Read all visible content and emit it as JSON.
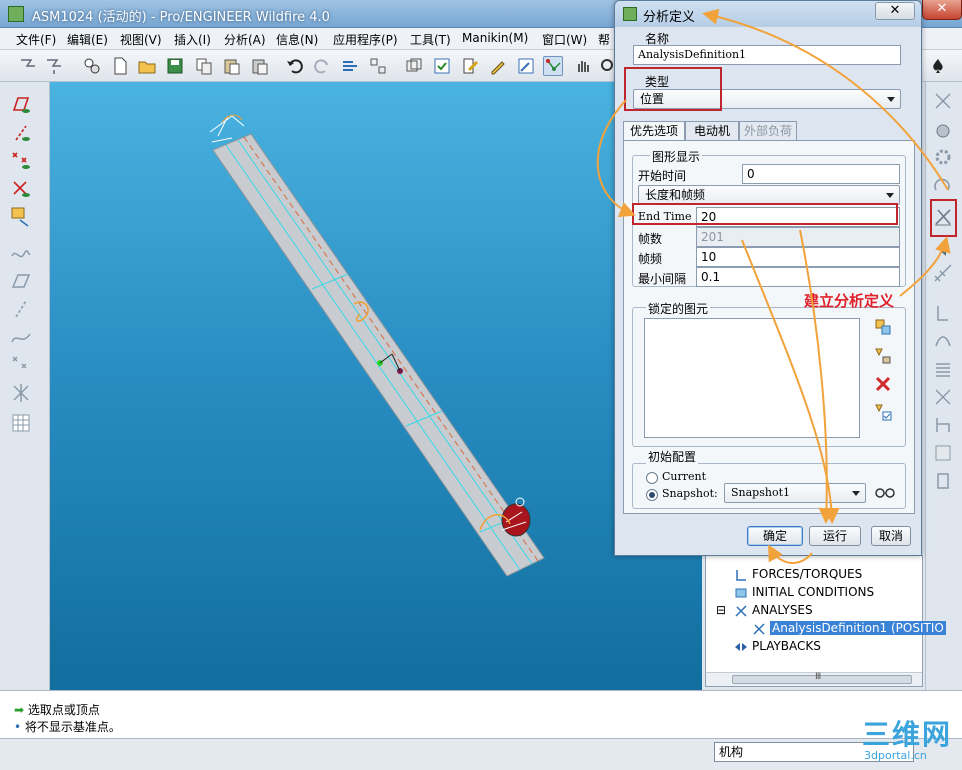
{
  "window": {
    "title": "ASM1024 (活动的) - Pro/ENGINEER Wildfire 4.0",
    "close_glyph": "✕"
  },
  "menu": [
    "文件(F)",
    "编辑(E)",
    "视图(V)",
    "插入(I)",
    "分析(A)",
    "信息(N)",
    "应用程序(P)",
    "工具(T)",
    "Manikin(M)",
    "窗口(W)",
    "帮"
  ],
  "dialog": {
    "title": "分析定义",
    "close_glyph": "✕",
    "name_label": "名称",
    "name_value": "AnalysisDefinition1",
    "type_label": "类型",
    "type_value": "位置",
    "tabs": [
      {
        "label": "优先选项",
        "state": "active"
      },
      {
        "label": "电动机",
        "state": "normal"
      },
      {
        "label": "外部负荷",
        "state": "disabled"
      }
    ],
    "graphics": {
      "group_label": "图形显示",
      "start_time_label": "开始时间",
      "start_time_value": "0",
      "mode_value": "长度和帧频",
      "end_time_label": "End Time",
      "end_time_value": "20",
      "frames_label": "帧数",
      "frames_value": "201",
      "frame_rate_label": "帧频",
      "frame_rate_value": "10",
      "min_interval_label": "最小间隔",
      "min_interval_value": "0.1"
    },
    "locked": {
      "group_label": "锁定的图元"
    },
    "initial": {
      "group_label": "初始配置",
      "current_label": "Current",
      "snapshot_label": "Snapshot:",
      "snapshot_value": "Snapshot1",
      "selected": "snapshot"
    },
    "buttons": {
      "ok": "确定",
      "run": "运行",
      "cancel": "取消"
    }
  },
  "model_tree": {
    "items": [
      {
        "label": "FORCES/TORQUES",
        "indent": 0,
        "selected": false,
        "expander": ""
      },
      {
        "label": "INITIAL CONDITIONS",
        "indent": 0,
        "selected": false,
        "expander": ""
      },
      {
        "label": "ANALYSES",
        "indent": 0,
        "selected": false,
        "expander": "⊟"
      },
      {
        "label": "AnalysisDefinition1 (POSITIO",
        "indent": 1,
        "selected": true,
        "expander": ""
      },
      {
        "label": "PLAYBACKS",
        "indent": 0,
        "selected": false,
        "expander": ""
      }
    ],
    "scroll_grip": "Ⅲ"
  },
  "messages": [
    "选取点或顶点",
    "将不显示基准点。"
  ],
  "status": {
    "mode_value": "机构"
  },
  "annotation": {
    "text": "建立分析定义",
    "arrow_color": "#f2a23a",
    "box_color": "#c0262e"
  },
  "watermark": {
    "big": "三维网",
    "small": "3dportal.cn"
  },
  "colors": {
    "viewport_top": "#4ab3e0",
    "viewport_bottom": "#116e9e",
    "selection": "#3a82d6"
  }
}
